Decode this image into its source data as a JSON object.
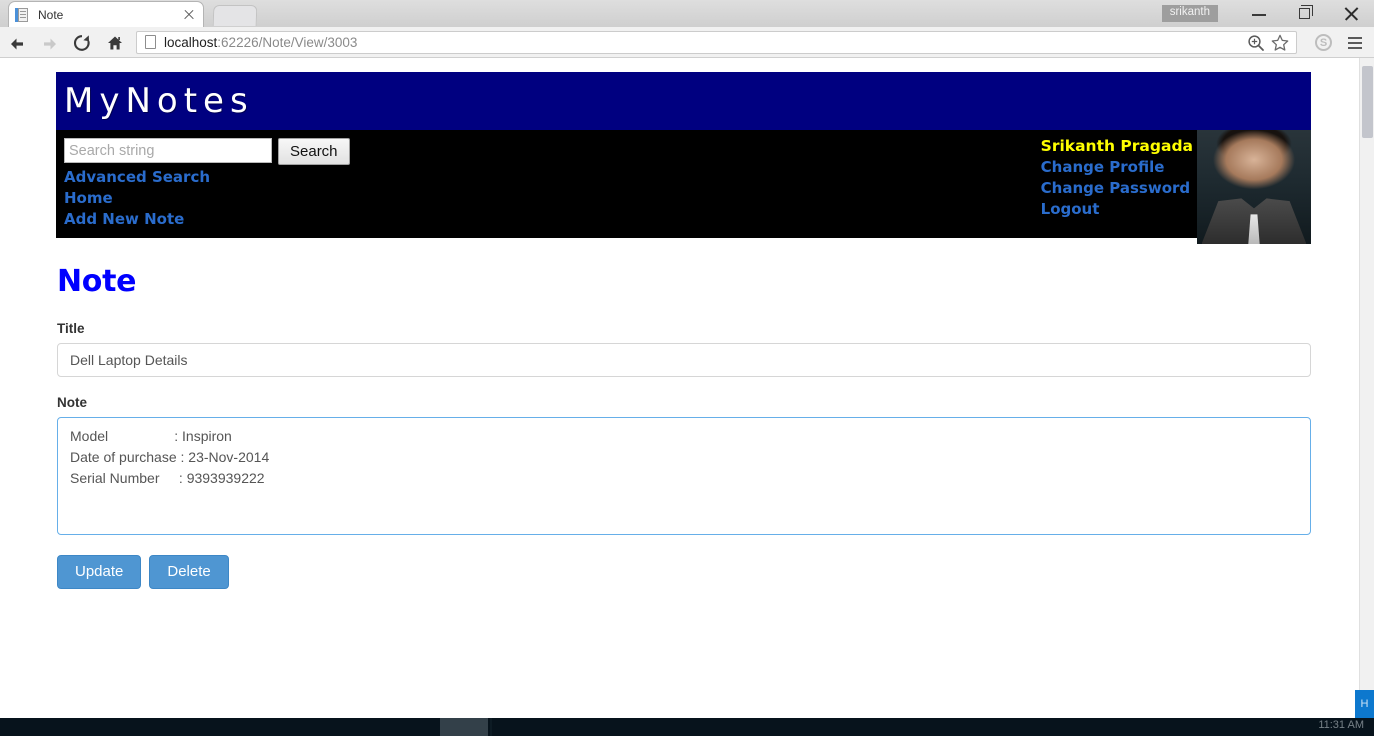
{
  "browser": {
    "tab": {
      "title": "Note",
      "favicon": "document-icon",
      "close": "×"
    },
    "newtab_label": "",
    "window": {
      "user_chip": "srikanth",
      "minimize": "–",
      "maximize": "❐",
      "close": "✕"
    },
    "toolbar": {
      "back": "back-arrow-icon",
      "forward": "forward-arrow-icon",
      "reload": "reload-icon",
      "home": "home-icon",
      "url_prefix": "localhost",
      "url_suffix": ":62226/Note/View/3003",
      "url_full": "localhost:62226/Note/View/3003",
      "zoom_icon": "zoom-in-icon",
      "bookmark_icon": "star-icon",
      "skype_label": "S",
      "menu_icon": "hamburger-menu-icon"
    }
  },
  "site": {
    "brand": "MyNotes",
    "search": {
      "placeholder": "Search string",
      "value": "",
      "button_label": "Search"
    },
    "nav_links": [
      {
        "label": "Advanced Search"
      },
      {
        "label": "Home"
      },
      {
        "label": "Add New Note"
      }
    ],
    "user": {
      "name": "Srikanth Pragada",
      "links": [
        {
          "label": "Change Profile"
        },
        {
          "label": "Change Password"
        },
        {
          "label": "Logout"
        }
      ],
      "avatar_alt": "user-photo"
    }
  },
  "main": {
    "page_title": "Note",
    "fields": {
      "title_label": "Title",
      "title_value": "Dell Laptop Details",
      "title_placeholder": "",
      "note_label": "Note",
      "note_value": "Model                 : Inspiron\nDate of purchase : 23-Nov-2014\nSerial Number     : 9393939222",
      "note_placeholder": ""
    },
    "buttons": {
      "update_label": "Update",
      "delete_label": "Delete"
    }
  },
  "taskbar": {
    "clock": "11:31 AM",
    "notification_label": "H"
  },
  "colors": {
    "header_navy": "#000080",
    "nav_black": "#000000",
    "link_blue": "#2a6ccc",
    "user_yellow": "#ffff00",
    "title_blue": "#0000ff",
    "button_blue": "#4f96d2",
    "focus_border": "#66afe9"
  }
}
